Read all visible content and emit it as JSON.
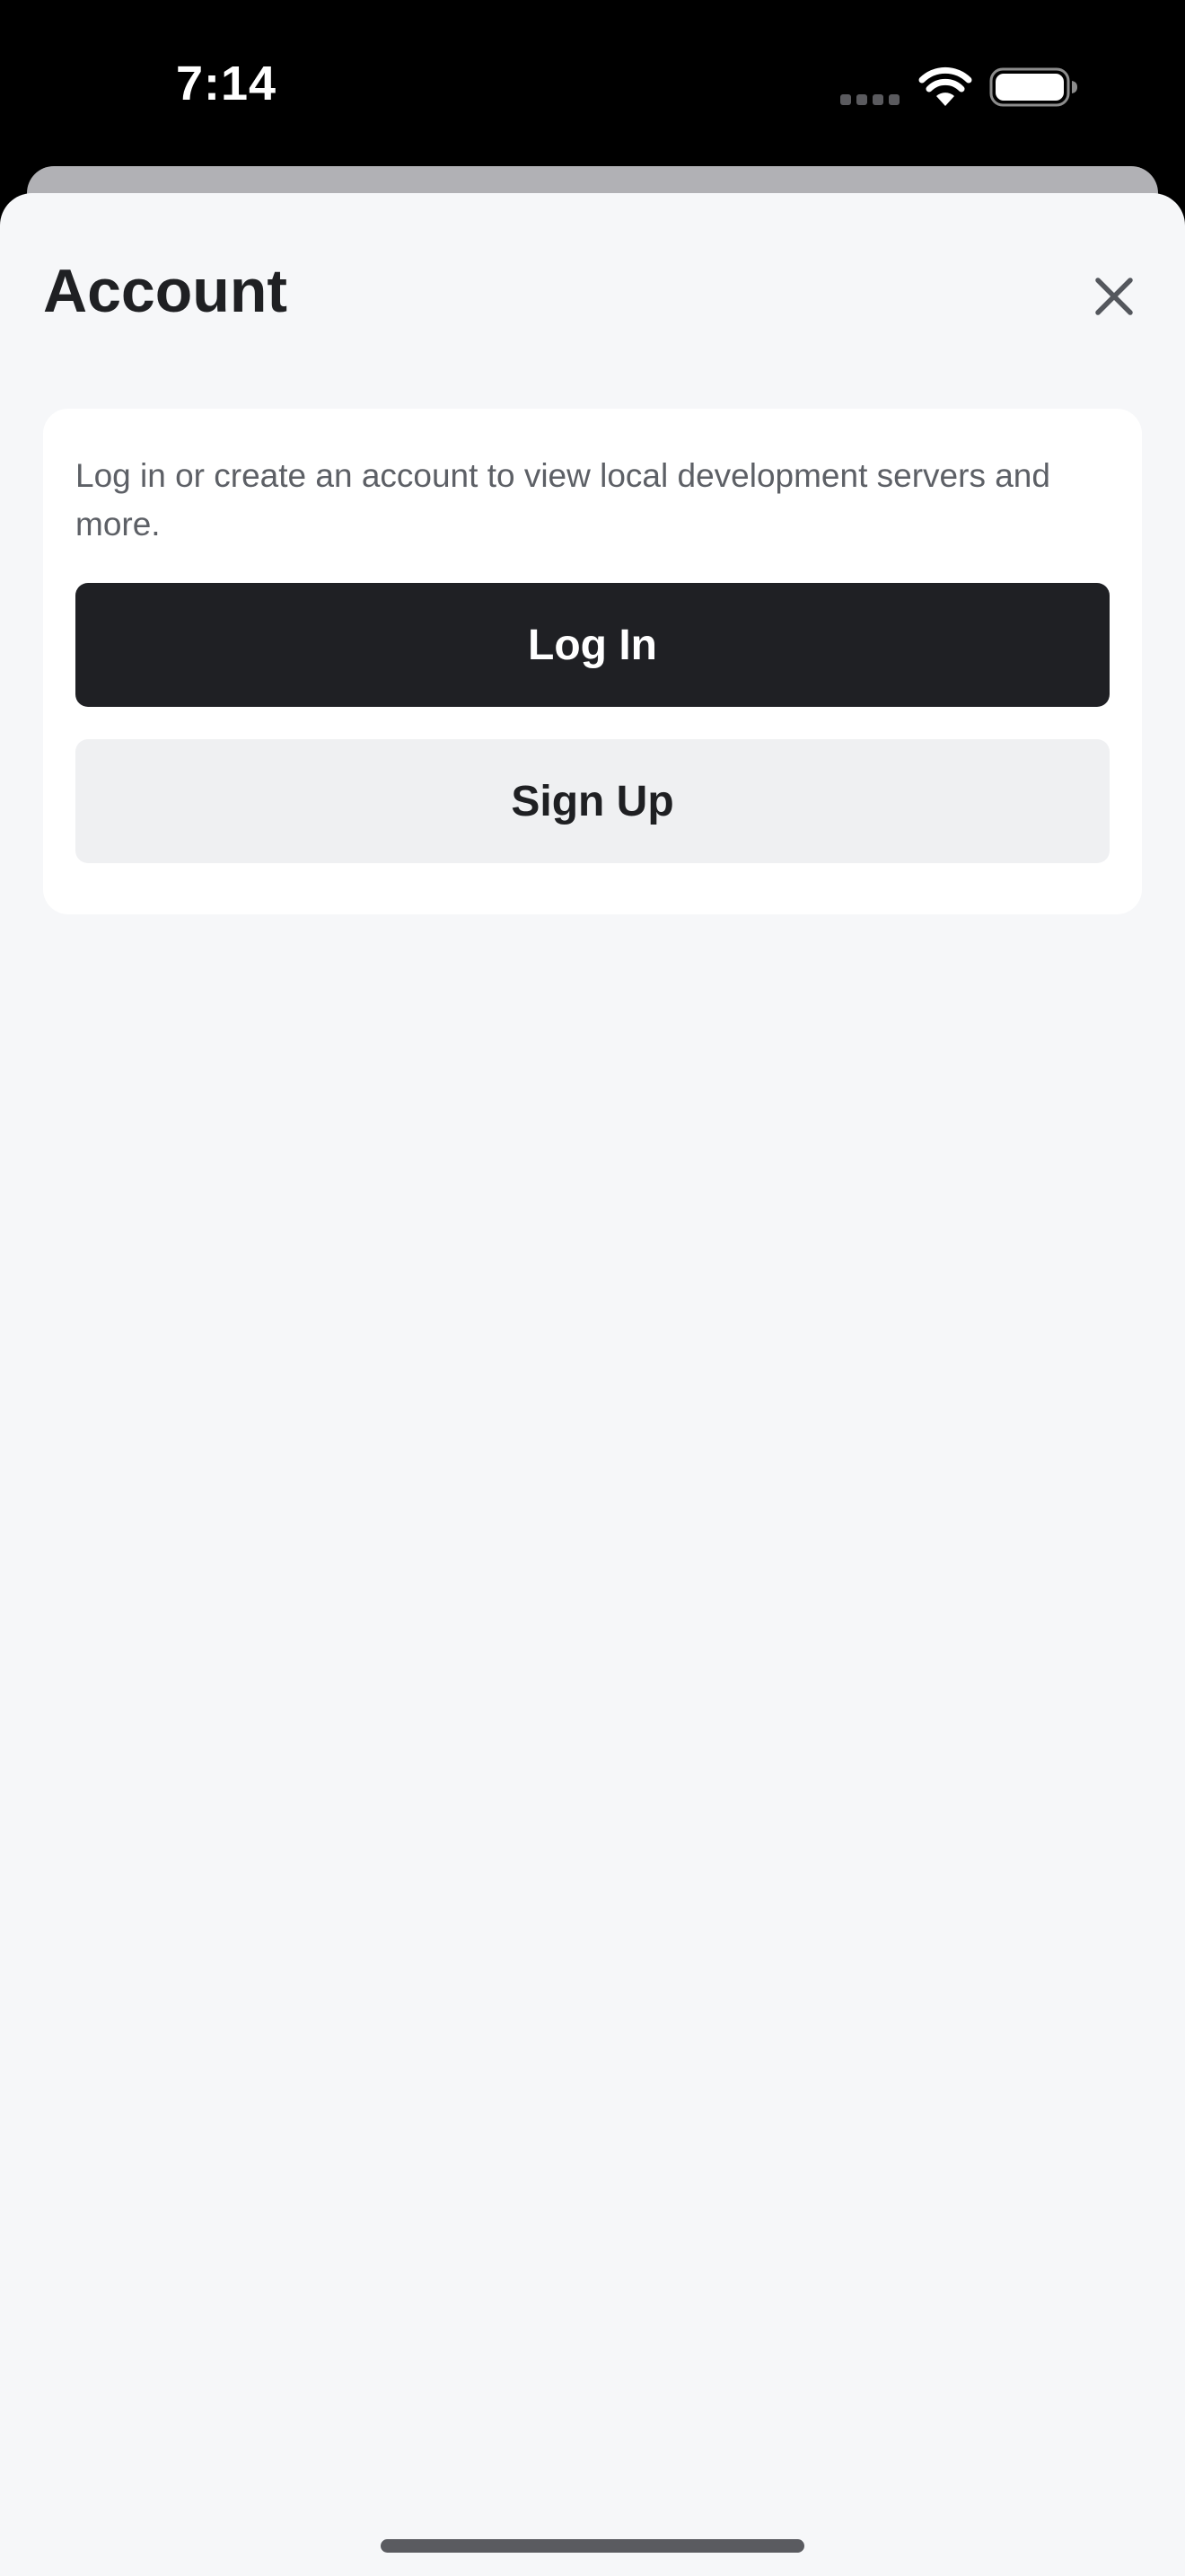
{
  "status_bar": {
    "time": "7:14",
    "icons": [
      "cellular-signal-icon",
      "wifi-icon",
      "battery-icon"
    ]
  },
  "sheet": {
    "title": "Account",
    "close_icon": "close-icon"
  },
  "account_card": {
    "description": "Log in or create an account to view local development servers and more.",
    "login_label": "Log In",
    "signup_label": "Sign Up"
  },
  "colors": {
    "primary_button": "#1f2024",
    "secondary_button": "#eff0f2",
    "sheet_background": "#f6f7f9",
    "card_background": "#ffffff"
  }
}
